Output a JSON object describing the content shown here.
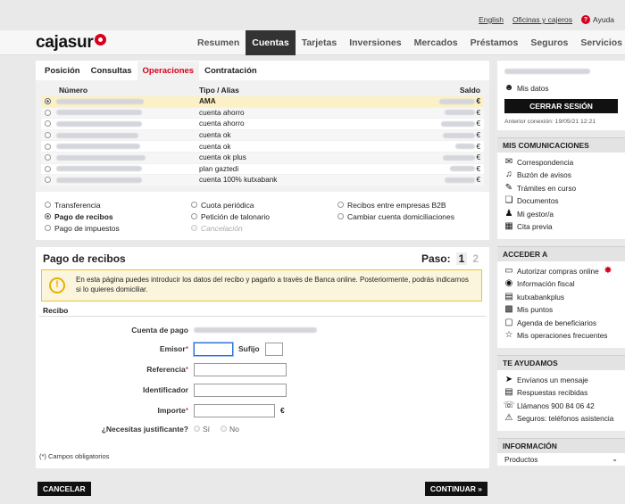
{
  "top": {
    "english": "English",
    "oficinas": "Oficinas y cajeros",
    "ayuda": "Ayuda"
  },
  "brand": {
    "name": "cajasur"
  },
  "nav": [
    "Resumen",
    "Cuentas",
    "Tarjetas",
    "Inversiones",
    "Mercados",
    "Préstamos",
    "Seguros",
    "Servicios"
  ],
  "subtabs": [
    "Posición",
    "Consultas",
    "Operaciones",
    "Contratación"
  ],
  "accounts": {
    "headers": {
      "numero": "Número",
      "tipo": "Tipo / Alias",
      "saldo": "Saldo"
    },
    "currency": "€",
    "rows": [
      {
        "alias": "AMA"
      },
      {
        "alias": "cuenta ahorro"
      },
      {
        "alias": "cuenta ahorro"
      },
      {
        "alias": "cuenta ok"
      },
      {
        "alias": "cuenta ok"
      },
      {
        "alias": "cuenta ok plus"
      },
      {
        "alias": "plan gaztedi"
      },
      {
        "alias": "cuenta 100% kutxabank"
      }
    ]
  },
  "operations": [
    {
      "label": "Transferencia",
      "state": "normal"
    },
    {
      "label": "Cuota periódica",
      "state": "normal"
    },
    {
      "label": "Recibos entre empresas B2B",
      "state": "normal"
    },
    {
      "label": "Pago de recibos",
      "state": "selected"
    },
    {
      "label": "Petición de talonario",
      "state": "normal"
    },
    {
      "label": "Cambiar cuenta domiciliaciones",
      "state": "normal"
    },
    {
      "label": "Pago de impuestos",
      "state": "normal"
    },
    {
      "label": "Cancelación",
      "state": "disabled"
    },
    {
      "label": "",
      "state": "none"
    }
  ],
  "pago": {
    "title": "Pago de recibos",
    "paso_label": "Paso:",
    "paso_current": "1",
    "paso_next": "2",
    "notice": "En esta página puedes introducir los datos del recibo y pagarlo a través de Banca online. Posteriormente, podrás indicarnos si lo quieres domiciliar.",
    "recibo_label": "Recibo",
    "cuenta_label": "Cuenta de pago",
    "emisor_label": "Emisor",
    "sufijo_label": "Sufijo",
    "referencia_label": "Referencia",
    "identificador_label": "Identificador",
    "importe_label": "Importe",
    "importe_currency": "€",
    "justificante_label": "¿Necesitas justificante?",
    "si": "Sí",
    "no": "No",
    "required_mark": "*",
    "obligatorios": "(*) Campos obligatorios"
  },
  "buttons": {
    "cancelar": "CANCELAR",
    "continuar": "CONTINUAR »"
  },
  "side": {
    "mis_datos": "Mis datos",
    "cerrar": "CERRAR SESIÓN",
    "anterior": "Anterior conexión: 19/05/21 12:21",
    "comunicaciones": {
      "title": "MIS COMUNICACIONES",
      "items": [
        "Correspondencia",
        "Buzón de avisos",
        "Trámites en curso",
        "Documentos",
        "Mi gestor/a",
        "Cita previa"
      ],
      "icons": [
        "envelope-icon",
        "bell-icon",
        "pencil-icon",
        "documents-icon",
        "person-icon",
        "calendar-icon"
      ]
    },
    "acceder": {
      "title": "ACCEDER A",
      "items": [
        "Autorizar compras online",
        "Información fiscal",
        "kutxabankplus",
        "Mis puntos",
        "Agenda de beneficiarios",
        "Mis operaciones frecuentes"
      ],
      "icons": [
        "card-icon",
        "piggy-icon",
        "briefcase-icon",
        "gift-icon",
        "contacts-icon",
        "star-icon"
      ],
      "new_badge": "✸"
    },
    "ayudamos": {
      "title": "TE AYUDAMOS",
      "items": [
        "Envíanos un mensaje",
        "Respuestas recibidas",
        "Llámanos 900 84 06 42",
        "Seguros: teléfonos asistencia"
      ],
      "icons": [
        "send-icon",
        "reply-icon",
        "phone-icon",
        "warning-icon"
      ]
    },
    "informacion": {
      "title": "INFORMACIÓN",
      "productos": "Productos"
    }
  },
  "colors": {
    "brand_red": "#d6001c",
    "notice_border": "#f0c419",
    "selected_row": "#fbf0c6"
  }
}
